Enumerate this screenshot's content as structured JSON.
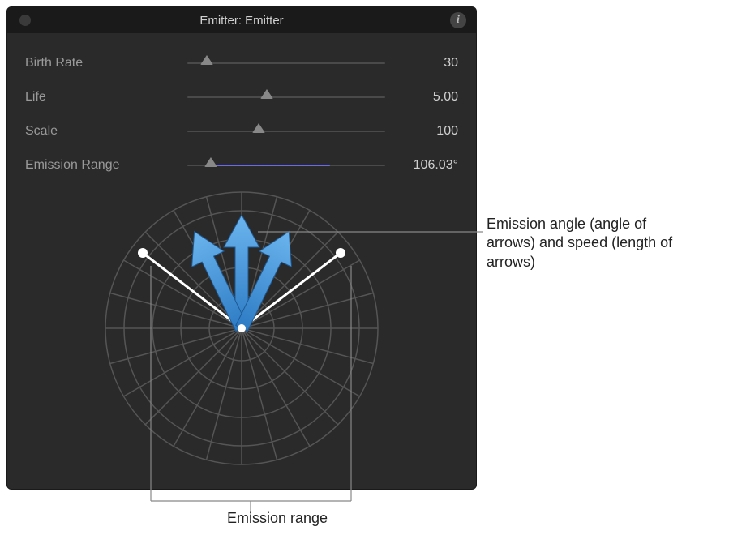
{
  "panel": {
    "title": "Emitter: Emitter",
    "info_glyph": "i"
  },
  "params": {
    "birth_rate": {
      "label": "Birth Rate",
      "value": "30",
      "pct": 10
    },
    "life": {
      "label": "Life",
      "value": "5.00",
      "pct": 40
    },
    "scale": {
      "label": "Scale",
      "value": "100",
      "pct": 36
    },
    "emission_range": {
      "label": "Emission Range",
      "value": "106.03°",
      "pct": 12,
      "fill_pct": 60
    }
  },
  "dial": {
    "emission_angle_deg": 90,
    "emission_range_deg": 106.03,
    "arrow_length_pct": 80
  },
  "annotations": {
    "right": "Emission angle (angle of arrows) and speed (length of arrows)",
    "bottom": "Emission range"
  },
  "icons": {
    "traffic_light": "close",
    "info": "info"
  },
  "colors": {
    "arrow": "#3a8fd9",
    "arrow_light": "#5da9e8",
    "dial_line": "#ffffff",
    "grid": "#555555",
    "accent": "#6a6af0"
  }
}
